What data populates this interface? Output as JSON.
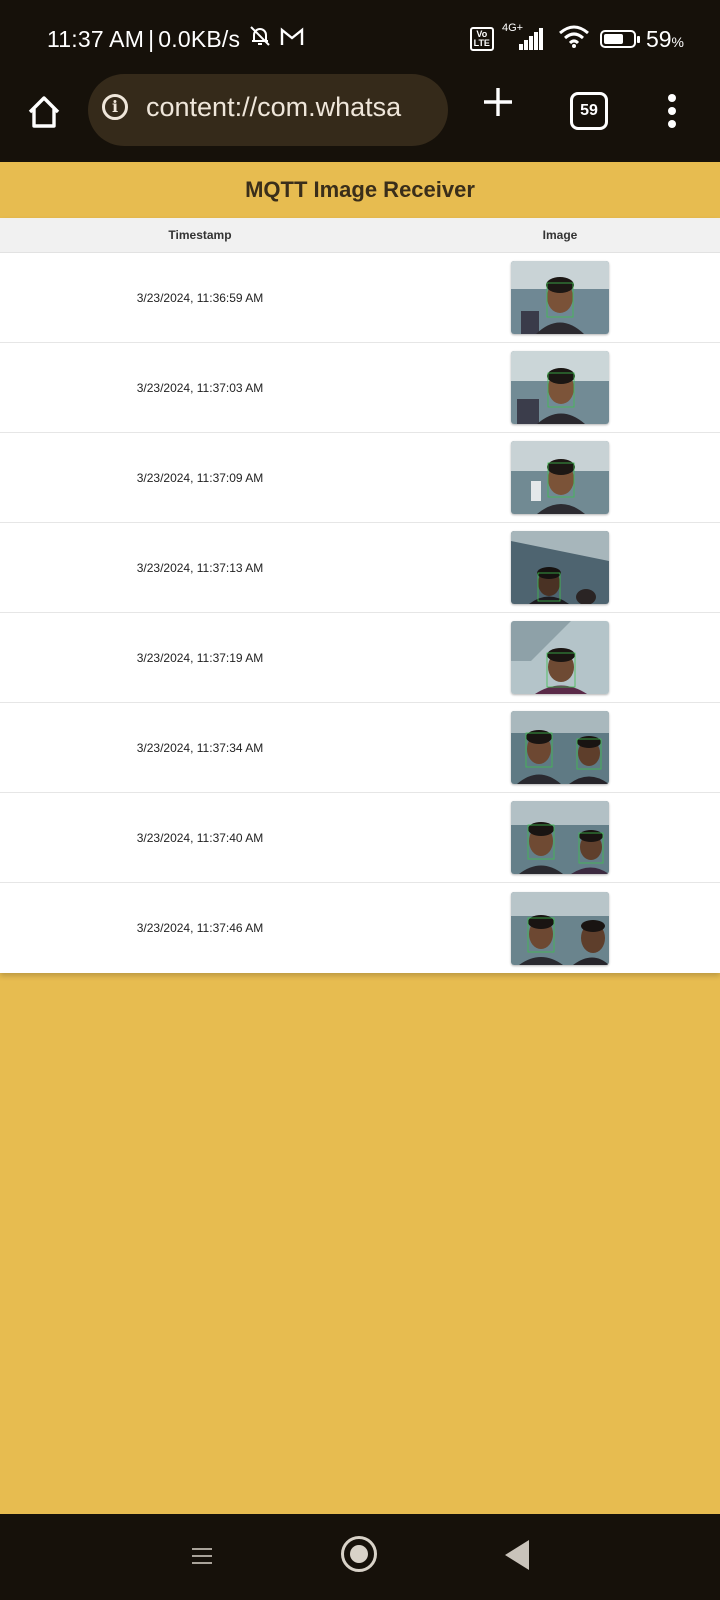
{
  "status_bar": {
    "time": "11:37 AM",
    "separator": "|",
    "network_speed": "0.0KB/s",
    "volte_label": "Vo\nLTE",
    "network_type": "4G+",
    "battery_percent": "59",
    "battery_unit": "%",
    "icons": [
      "bell-off-icon",
      "gmail-icon",
      "volte-icon",
      "signal-icon",
      "wifi-icon",
      "battery-icon"
    ]
  },
  "browser": {
    "url": "content://com.whatsa",
    "tab_count": "59",
    "icons": [
      "home-icon",
      "info-icon",
      "plus-icon",
      "tabs-icon",
      "more-vert-icon"
    ]
  },
  "page": {
    "title": "MQTT Image Receiver",
    "columns": [
      "Timestamp",
      "Image"
    ],
    "rows": [
      {
        "timestamp": "3/23/2024, 11:36:59 AM"
      },
      {
        "timestamp": "3/23/2024, 11:37:03 AM"
      },
      {
        "timestamp": "3/23/2024, 11:37:09 AM"
      },
      {
        "timestamp": "3/23/2024, 11:37:13 AM"
      },
      {
        "timestamp": "3/23/2024, 11:37:19 AM"
      },
      {
        "timestamp": "3/23/2024, 11:37:34 AM"
      },
      {
        "timestamp": "3/23/2024, 11:37:40 AM"
      },
      {
        "timestamp": "3/23/2024, 11:37:46 AM"
      }
    ]
  },
  "nav_bar": {
    "icons": [
      "recents-icon",
      "home-circle-icon",
      "back-icon"
    ]
  },
  "colors": {
    "page_background": "#e7bc50",
    "system_bar": "#16110a",
    "url_bar": "#352a1a",
    "title_text": "#3a2e1a"
  }
}
